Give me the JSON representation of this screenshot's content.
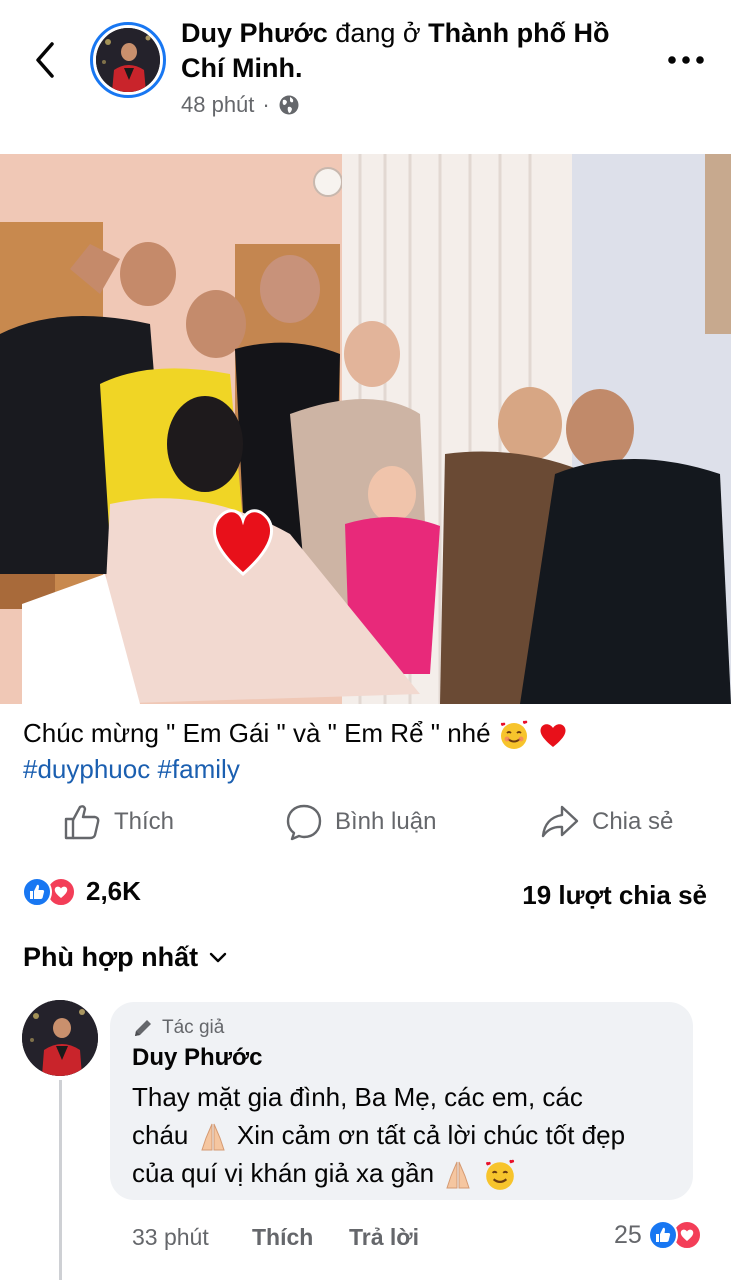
{
  "header": {
    "author": "Duy Phước",
    "checkin_text": "đang ở",
    "location": "Thành phố Hồ Chí Minh.",
    "time": "48 phút",
    "privacy_icon": "globe-icon",
    "back_icon": "chevron-left-icon",
    "more_icon": "more-dots-icon"
  },
  "post": {
    "caption": "Chúc mừng \" Em Gái \" và \" Em Rể \" nhé",
    "caption_emojis": [
      "smiling-face-with-hearts",
      "red-heart"
    ],
    "hashtags": [
      "#duyphuoc",
      "#family"
    ]
  },
  "actions": {
    "like": "Thích",
    "comment": "Bình luận",
    "share": "Chia sẻ"
  },
  "stats": {
    "reaction_count": "2,6K",
    "shares": "19 lượt chia sẻ"
  },
  "comments_sort": {
    "label": "Phù hợp nhất"
  },
  "comment": {
    "badge": "Tác giả",
    "name": "Duy Phước",
    "line1": "Thay mặt gia đình, Ba Mẹ, các em, các",
    "line2a": "cháu",
    "line2b": "Xin cảm ơn tất cả lời chúc tốt đẹp",
    "line3": "của quí vị khán giả xa gần",
    "time": "33 phút",
    "like": "Thích",
    "reply": "Trả lời",
    "reaction_count": "25"
  },
  "colors": {
    "accent": "#1877f2",
    "heart": "#f33e58",
    "hashtag": "#1b5fb0",
    "muted": "#65676b"
  }
}
